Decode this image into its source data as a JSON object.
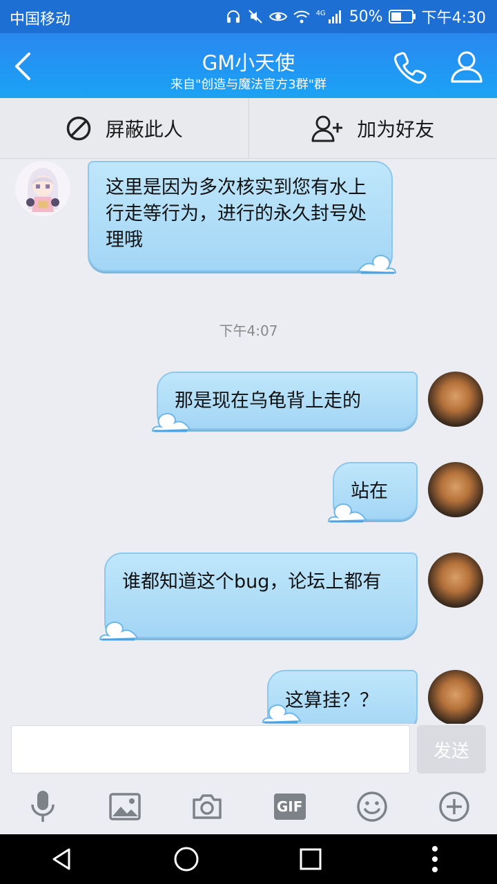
{
  "status_bar": {
    "carrier": "中国移动",
    "network": "4G",
    "battery": "50%",
    "time": "下午4:30"
  },
  "header": {
    "title": "GM小天使",
    "subtitle": "来自\"创造与魔法官方3群\"群",
    "back_icon": "chevron-left-icon",
    "call_icon": "phone-icon",
    "profile_icon": "person-icon"
  },
  "actions": {
    "block_label": "屏蔽此人",
    "add_friend_label": "加为好友"
  },
  "messages": [
    {
      "from": "other",
      "text": "这里是因为多次核实到您有水上行走等行为，进行的永久封号处理哦"
    },
    {
      "from": "timestamp",
      "text": "下午4:07"
    },
    {
      "from": "self",
      "text": "那是现在乌龟背上走的"
    },
    {
      "from": "self",
      "text": "站在"
    },
    {
      "from": "self",
      "text": "谁都知道这个bug，论坛上都有"
    },
    {
      "from": "self",
      "text": "这算挂？？"
    }
  ],
  "composer": {
    "input_value": "",
    "send_label": "发送",
    "toolbar_icons": [
      "microphone-icon",
      "image-icon",
      "camera-icon",
      "gif-icon",
      "emoji-icon",
      "plus-icon"
    ],
    "gif_label": "GIF"
  },
  "colors": {
    "status_bar": "#1e6fd3",
    "title_bar": "#1aa3f5",
    "bubble": "#a3d6f5",
    "background": "#ebedf2"
  }
}
